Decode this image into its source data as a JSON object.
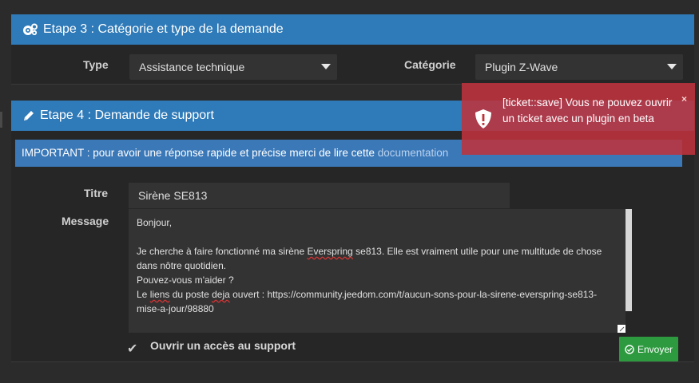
{
  "step3": {
    "title": "Etape 3 : Catégorie et type de la demande",
    "type_label": "Type",
    "type_value": "Assistance technique",
    "category_label": "Catégorie",
    "category_value": "Plugin Z-Wave"
  },
  "step4": {
    "title": "Etape 4 : Demande de support",
    "important_bold": "IMPORTANT : pour avoir une réponse rapide et précise merci de lire cette",
    "important_link": "documentation",
    "title_label": "Titre",
    "title_value": "Sirène SE813",
    "message_label": "Message",
    "message_lines": [
      "Bonjour,",
      "",
      "Je cherche à faire fonctionné ma sirène Everspring se813. Elle est vraiment utile pour une multitude de chose",
      "dans nôtre quotidien.",
      "Pouvez-vous m'aider ?",
      "Le liens du poste deja ouvert : https://community.jeedom.com/t/aucun-sons-pour-la-sirene-everspring-se813-",
      "mise-a-jour/98880"
    ],
    "support_access_label": "Ouvrir un accès au support",
    "send_label": "Envoyer"
  },
  "alert": {
    "message": "[ticket::save] Vous ne pouvez ouvrir un ticket avec un plugin en beta",
    "close": "×"
  },
  "colors": {
    "header_blue": "#2f7ab8",
    "alert_red": "#be323c",
    "send_green": "#2e9a40"
  }
}
